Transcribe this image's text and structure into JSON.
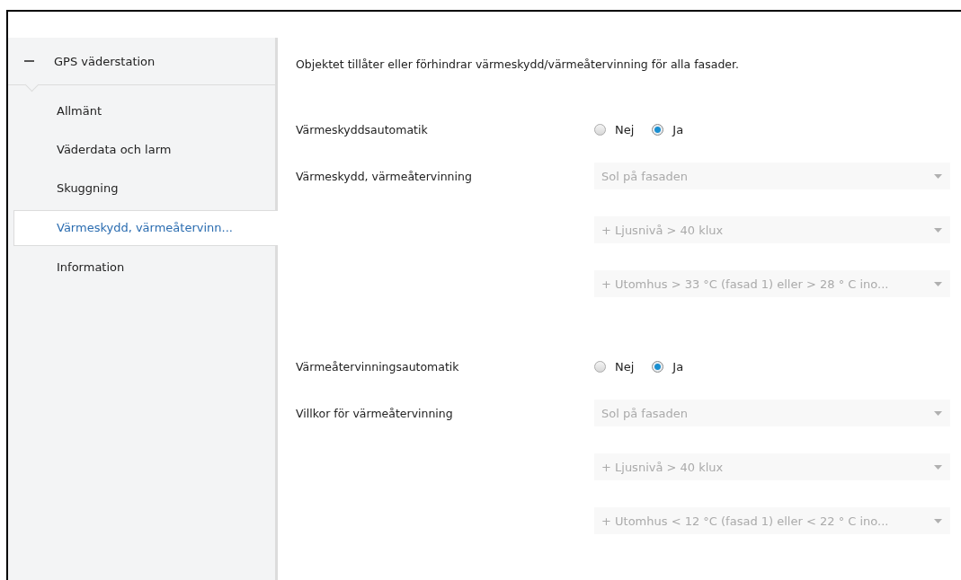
{
  "sidebar": {
    "group": {
      "label": "GPS väderstation",
      "expanded": true
    },
    "items": [
      {
        "label": "Allmänt",
        "selected": false
      },
      {
        "label": "Väderdata och larm",
        "selected": false
      },
      {
        "label": "Skuggning",
        "selected": false
      },
      {
        "label": "Värmeskydd, värmeåtervinn...",
        "selected": true
      },
      {
        "label": "Information",
        "selected": false
      }
    ]
  },
  "content": {
    "description": "Objektet tillåter eller förhindrar värmeskydd/värmeåtervinning för alla fasader.",
    "sections": [
      {
        "rows": [
          {
            "kind": "radio",
            "label": "Värmeskyddsautomatik",
            "options": [
              {
                "label": "Nej",
                "selected": false
              },
              {
                "label": "Ja",
                "selected": true
              }
            ]
          },
          {
            "kind": "dropdown",
            "label": "Värmeskydd, värmeåtervinning",
            "value": "Sol på fasaden",
            "disabled": true
          },
          {
            "kind": "dropdown",
            "value": "+ Ljusnivå > 40 klux",
            "disabled": true
          },
          {
            "kind": "dropdown",
            "value": "+ Utomhus  > 33 °C (fasad 1) eller > 28 ° C ino...",
            "disabled": true
          }
        ]
      },
      {
        "rows": [
          {
            "kind": "radio",
            "label": "Värmeåtervinningsautomatik",
            "options": [
              {
                "label": "Nej",
                "selected": false
              },
              {
                "label": "Ja",
                "selected": true
              }
            ]
          },
          {
            "kind": "dropdown",
            "label": "Villkor för värmeåtervinning",
            "value": "Sol på fasaden",
            "disabled": true
          },
          {
            "kind": "dropdown",
            "value": "+ Ljusnivå > 40 klux",
            "disabled": true
          },
          {
            "kind": "dropdown",
            "value": "+ Utomhus  < 12 °C (fasad 1) eller < 22 ° C ino...",
            "disabled": true
          }
        ]
      }
    ]
  }
}
